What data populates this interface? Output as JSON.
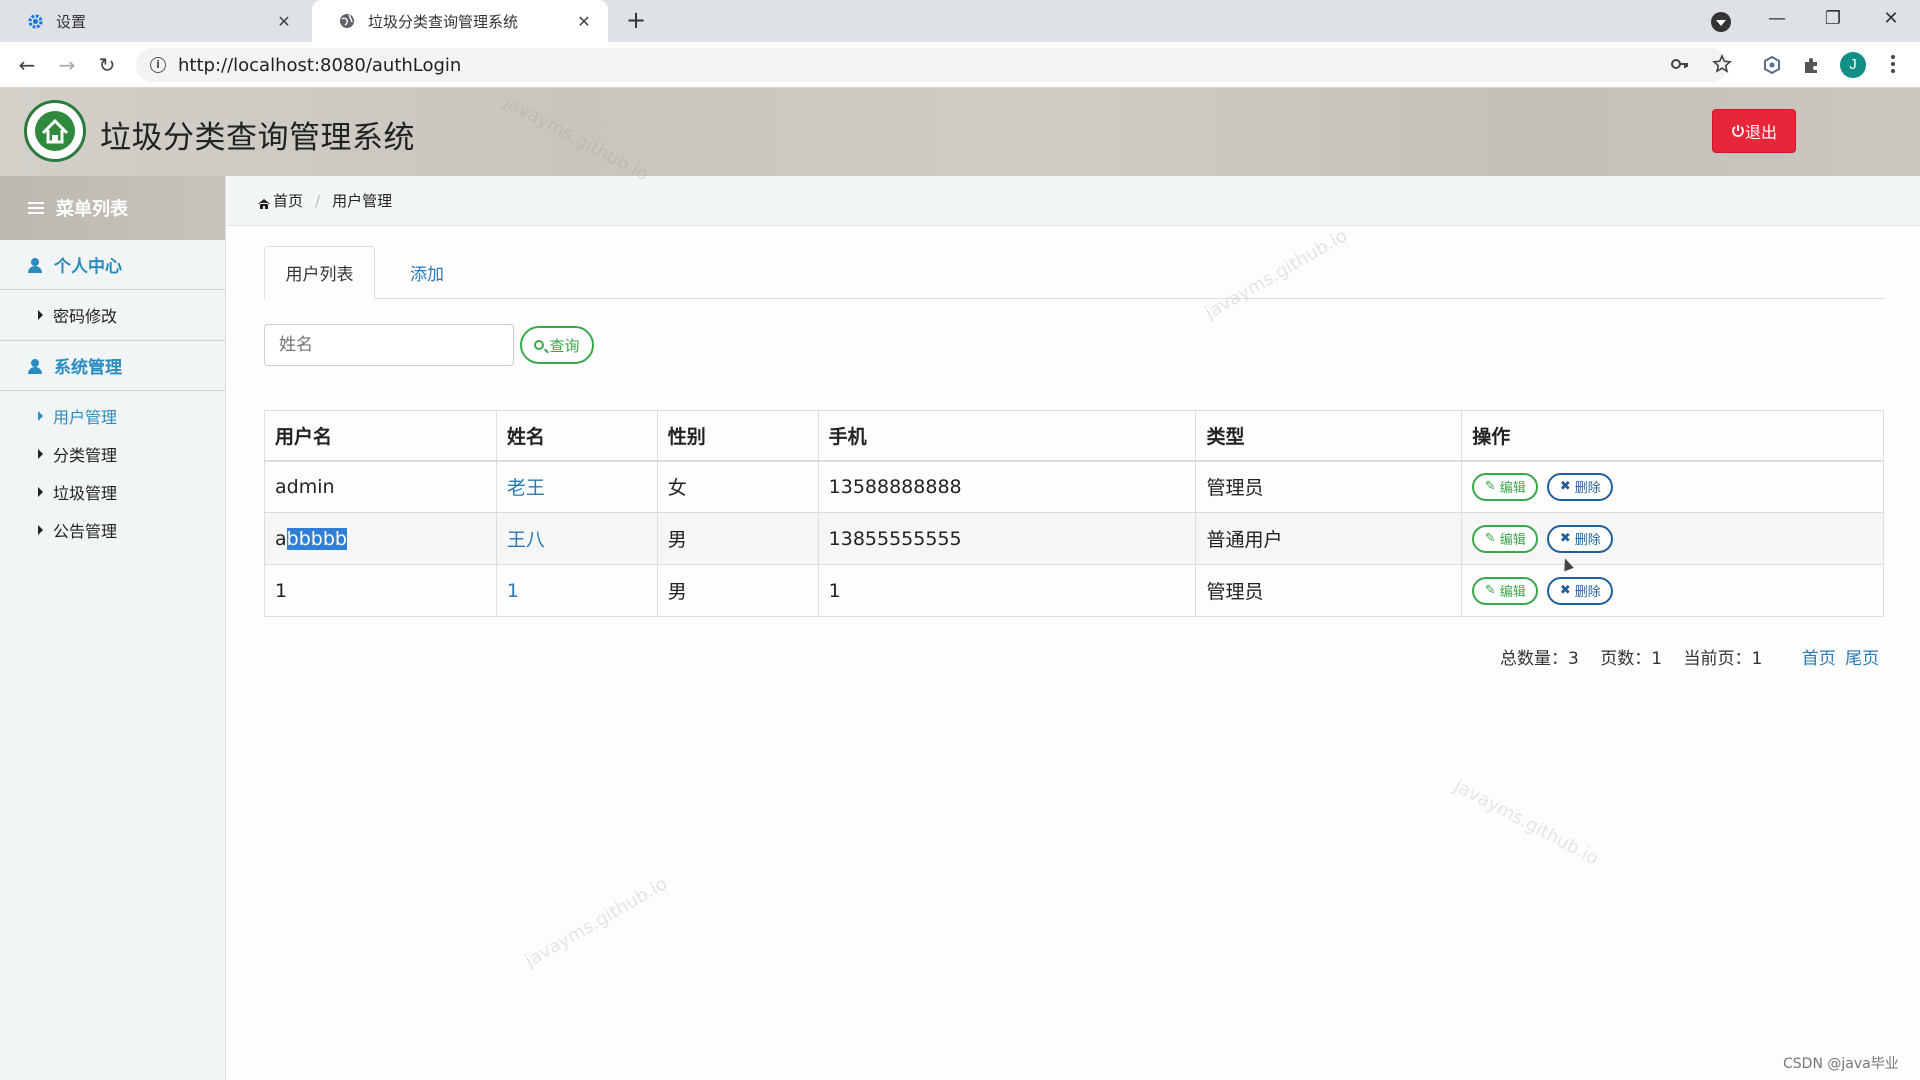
{
  "browser": {
    "tabs": [
      {
        "title": "设置",
        "icon": "gear-icon"
      },
      {
        "title": "垃圾分类查询管理系统",
        "icon": "globe-icon"
      }
    ],
    "url": "http://localhost:8080/authLogin",
    "avatar_letter": "J"
  },
  "header": {
    "title": "垃圾分类查询管理系统",
    "logout_label": "退出"
  },
  "sidebar": {
    "title": "菜单列表",
    "groups": [
      {
        "label": "个人中心",
        "items": [
          {
            "label": "密码修改"
          }
        ]
      },
      {
        "label": "系统管理",
        "items": [
          {
            "label": "用户管理"
          },
          {
            "label": "分类管理"
          },
          {
            "label": "垃圾管理"
          },
          {
            "label": "公告管理"
          }
        ]
      }
    ]
  },
  "breadcrumb": {
    "home": "首页",
    "current": "用户管理"
  },
  "tabs": {
    "list": "用户列表",
    "add": "添加"
  },
  "search": {
    "placeholder": "姓名",
    "button": "查询"
  },
  "table": {
    "headers": [
      "用户名",
      "姓名",
      "性别",
      "手机",
      "类型",
      "操作"
    ],
    "rows": [
      {
        "username": "admin",
        "username_head": "admin",
        "username_sel": "",
        "name": "老王",
        "gender": "女",
        "phone": "13588888888",
        "type": "管理员"
      },
      {
        "username": "abbbbb",
        "username_head": "a",
        "username_sel": "bbbbb",
        "name": "王八",
        "gender": "男",
        "phone": "13855555555",
        "type": "普通用户"
      },
      {
        "username": "1",
        "username_head": "1",
        "username_sel": "",
        "name": "1",
        "gender": "男",
        "phone": "1",
        "type": "管理员"
      }
    ],
    "edit_label": "编辑",
    "delete_label": "删除"
  },
  "pager": {
    "total": "总数量：3",
    "pages": "页数：1",
    "current": "当前页：1",
    "first": "首页",
    "last": "尾页"
  },
  "watermark": "javayms.github.io",
  "credit": "CSDN @java毕业"
}
